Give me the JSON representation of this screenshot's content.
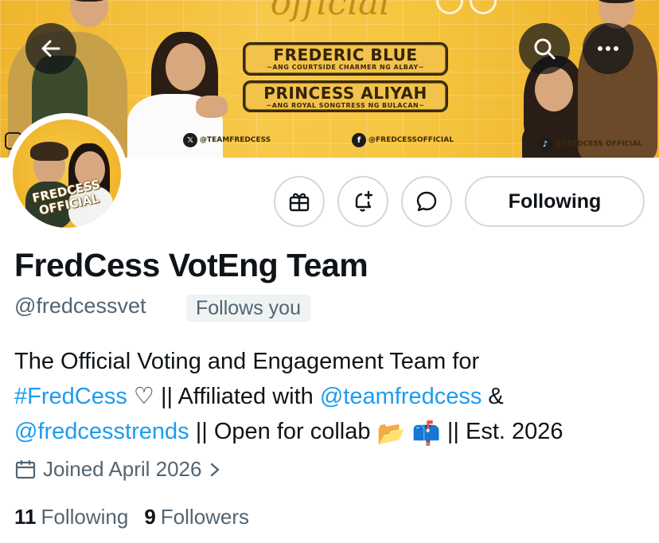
{
  "banner": {
    "script_title": "official",
    "plates": [
      {
        "name": "FREDERIC BLUE",
        "tagline": "~ANG COURTSIDE CHARMER NG ALBAY~"
      },
      {
        "name": "PRINCESS ALIYAH",
        "tagline": "~ANG ROYAL SONGTRESS NG BULACAN~"
      }
    ],
    "socials": {
      "x": {
        "icon": "x-logo-icon",
        "label": "@TEAMFREDCESS"
      },
      "facebook": {
        "icon": "facebook-logo-icon",
        "label": "@FREDCESSOFFICIAL"
      },
      "tiktok": {
        "icon": "tiktok-logo-icon",
        "label": "@FREDCESS OFFICIAL"
      }
    }
  },
  "avatar": {
    "line1": "FREDCESS",
    "line2": "OFFICIAL"
  },
  "actions": {
    "back": "back-arrow-icon",
    "search": "search-icon",
    "more": "more-icon",
    "gift": "gift-icon",
    "notify": "notification-bell-icon",
    "message": "message-icon",
    "following_label": "Following"
  },
  "profile": {
    "display_name": "FredCess VotEng Team",
    "handle": "@fredcessvet",
    "follows_you": "Follows you",
    "bio": {
      "t1": "The Official Voting and Engagement Team for",
      "hashtag": "#FredCess",
      "t2": " ♡ || Affiliated with ",
      "mention1": "@teamfredcess",
      "t3": " &",
      "mention2": "@fredcesstrends",
      "t4": " || Open for collab ",
      "emoji": "📂 📫",
      "t5": " || Est. 2026"
    },
    "joined": "Joined April 2026",
    "following_count": "11",
    "following_label": "Following",
    "followers_count": "9",
    "followers_label": "Followers"
  },
  "colors": {
    "accent_link": "#1d9bf0",
    "text_primary": "#0f1419",
    "text_secondary": "#536471",
    "banner_gold": "#f4bf3f"
  }
}
